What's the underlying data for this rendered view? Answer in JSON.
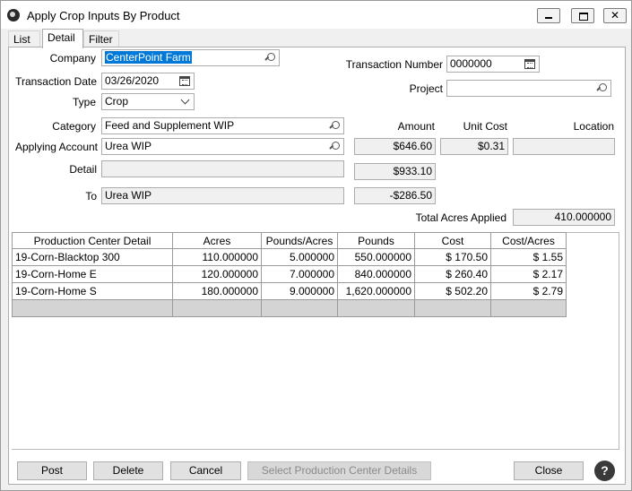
{
  "window": {
    "title": "Apply Crop Inputs By Product",
    "minimize_icon": "minimize-icon",
    "maximize_icon": "maximize-icon",
    "close_glyph": "✕"
  },
  "tabs": [
    {
      "label": "List"
    },
    {
      "label": "Detail",
      "active": true
    },
    {
      "label": "Filter"
    }
  ],
  "form": {
    "company_label": "Company",
    "company_value": "CenterPoint Farm",
    "transaction_date_label": "Transaction Date",
    "transaction_date_value": "03/26/2020",
    "type_label": "Type",
    "type_value": "Crop",
    "transaction_number_label": "Transaction Number",
    "transaction_number_value": "0000000",
    "project_label": "Project",
    "project_value": "",
    "category_label": "Category",
    "category_value": "Feed and Supplement WIP",
    "applying_account_label": "Applying Account",
    "applying_account_value": "Urea WIP",
    "detail_label": "Detail",
    "detail_value": "",
    "to_label": "To",
    "to_value": "Urea WIP",
    "amount_label": "Amount",
    "unit_cost_label": "Unit Cost",
    "location_label": "Location",
    "amount_applying": "$646.60",
    "unit_cost_value": "$0.31",
    "location_value": "",
    "amount_detail": "$933.10",
    "amount_to": "-$286.50",
    "total_acres_label": "Total Acres Applied",
    "total_acres_value": "410.000000"
  },
  "grid": {
    "columns": [
      "Production Center Detail",
      "Acres",
      "Pounds/Acres",
      "Pounds",
      "Cost",
      "Cost/Acres"
    ],
    "rows": [
      [
        "19-Corn-Blacktop 300",
        "110.000000",
        "5.000000",
        "550.000000",
        "$ 170.50",
        "$ 1.55"
      ],
      [
        "19-Corn-Home E",
        "120.000000",
        "7.000000",
        "840.000000",
        "$ 260.40",
        "$ 2.17"
      ],
      [
        "19-Corn-Home S",
        "180.000000",
        "9.000000",
        "1,620.000000",
        "$ 502.20",
        "$ 2.79"
      ]
    ]
  },
  "buttons": {
    "post": "Post",
    "delete": "Delete",
    "cancel": "Cancel",
    "select_production": "Select Production Center Details",
    "close": "Close",
    "help": "?"
  }
}
